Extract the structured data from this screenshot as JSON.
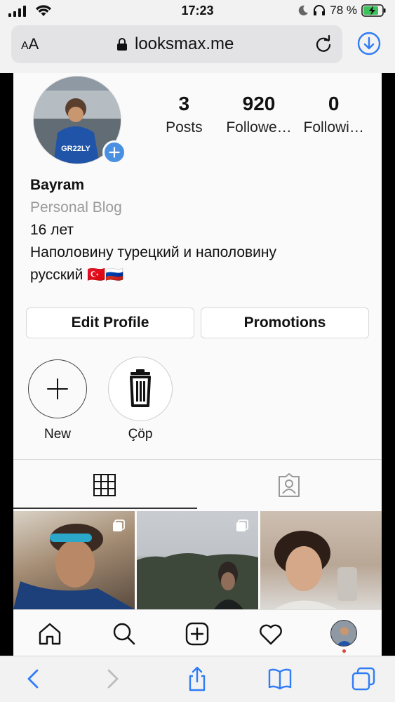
{
  "status_bar": {
    "time": "17:23",
    "battery_percent": "78 %"
  },
  "browser": {
    "text_size_label_small": "A",
    "text_size_label_large": "A",
    "url": "looksmax.me"
  },
  "profile": {
    "stats": [
      {
        "value": "3",
        "label": "Posts"
      },
      {
        "value": "920",
        "label": "Followe…"
      },
      {
        "value": "0",
        "label": "Followi…"
      }
    ],
    "name": "Bayram",
    "category": "Personal Blog",
    "bio_line1": "16 лет",
    "bio_line2": "Наполовину турецкий и наполовину",
    "bio_line3": "русский 🇹🇷🇷🇺",
    "edit_label": "Edit Profile",
    "promotions_label": "Promotions"
  },
  "highlights": [
    {
      "label": "New",
      "icon": "plus-icon"
    },
    {
      "label": "Çöp",
      "icon": "trash-icon"
    }
  ],
  "colors": {
    "accent_blue": "#4a90e2",
    "safari_blue": "#2f7cf6",
    "notification_dot": "#e0453c"
  }
}
